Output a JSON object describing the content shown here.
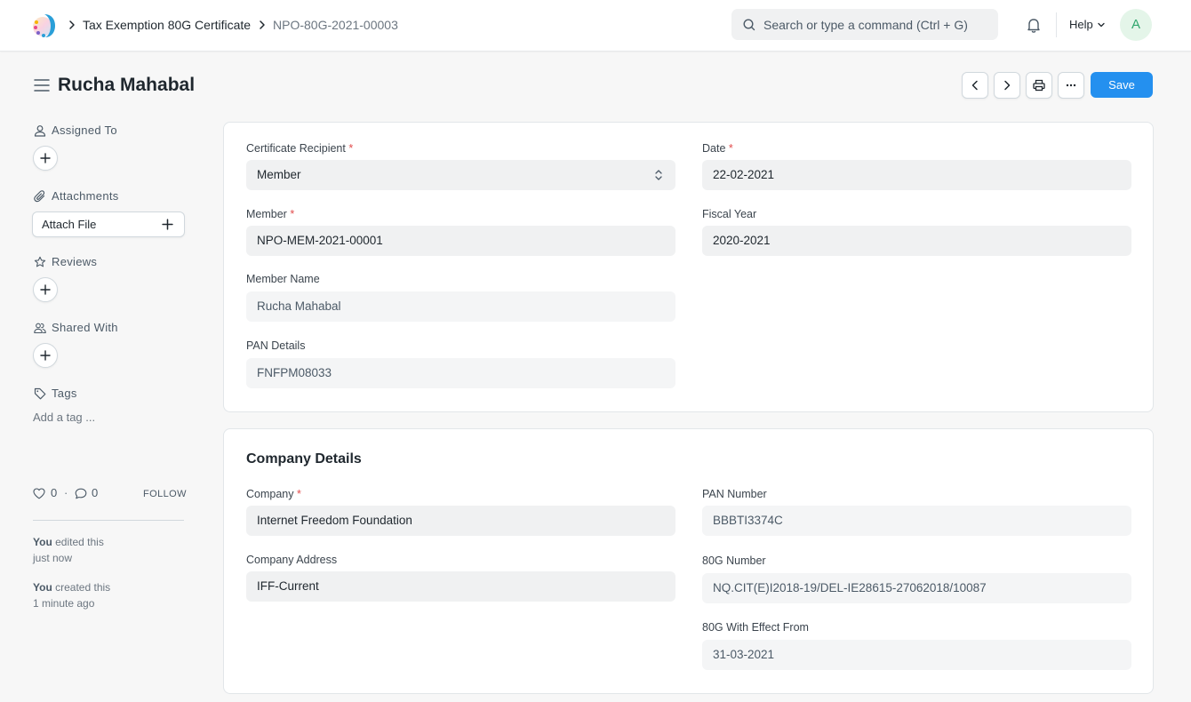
{
  "navbar": {
    "breadcrumbs": [
      "Tax Exemption 80G Certificate",
      "NPO-80G-2021-00003"
    ],
    "search_placeholder": "Search or type a command (Ctrl + G)",
    "help_label": "Help",
    "avatar_initial": "A"
  },
  "page": {
    "title": "Rucha Mahabal",
    "save_label": "Save"
  },
  "sidebar": {
    "assigned_to": "Assigned To",
    "attachments": "Attachments",
    "attach_file": "Attach File",
    "reviews": "Reviews",
    "shared_with": "Shared With",
    "tags": "Tags",
    "add_tag": "Add a tag ...",
    "likes": "0",
    "comments": "0",
    "follow": "FOLLOW",
    "activity": [
      {
        "who": "You",
        "action": "edited this",
        "when": "just now"
      },
      {
        "who": "You",
        "action": "created this",
        "when": "1 minute ago"
      }
    ]
  },
  "form": {
    "certificate_recipient": {
      "label": "Certificate Recipient",
      "value": "Member"
    },
    "date": {
      "label": "Date",
      "value": "22-02-2021"
    },
    "member": {
      "label": "Member",
      "value": "NPO-MEM-2021-00001"
    },
    "fiscal_year": {
      "label": "Fiscal Year",
      "value": "2020-2021"
    },
    "member_name": {
      "label": "Member Name",
      "value": "Rucha Mahabal"
    },
    "pan_details": {
      "label": "PAN Details",
      "value": "FNFPM08033"
    }
  },
  "company_section": {
    "title": "Company Details",
    "company": {
      "label": "Company",
      "value": "Internet Freedom Foundation"
    },
    "pan_number": {
      "label": "PAN Number",
      "value": "BBBTI3374C"
    },
    "company_address": {
      "label": "Company Address",
      "value": "IFF-Current"
    },
    "number_80g": {
      "label": "80G Number",
      "value": "NQ.CIT(E)I2018-19/DEL-IE28615-27062018/10087"
    },
    "effect_from": {
      "label": "80G With Effect From",
      "value": "31-03-2021"
    }
  },
  "colors": {
    "primary": "#2490ef",
    "required": "#e24c4c",
    "avatar_bg": "#e4f5e9",
    "avatar_fg": "#30a66d"
  },
  "icons": [
    "app-logo-icon",
    "chevron-right-icon",
    "search-icon",
    "bell-icon",
    "chevron-down-icon",
    "hamburger-icon",
    "chevron-left-icon",
    "printer-icon",
    "ellipsis-icon",
    "user-icon",
    "paperclip-icon",
    "plus-icon",
    "star-icon",
    "users-icon",
    "tag-icon",
    "heart-icon",
    "comment-icon",
    "select-caret-icon"
  ]
}
